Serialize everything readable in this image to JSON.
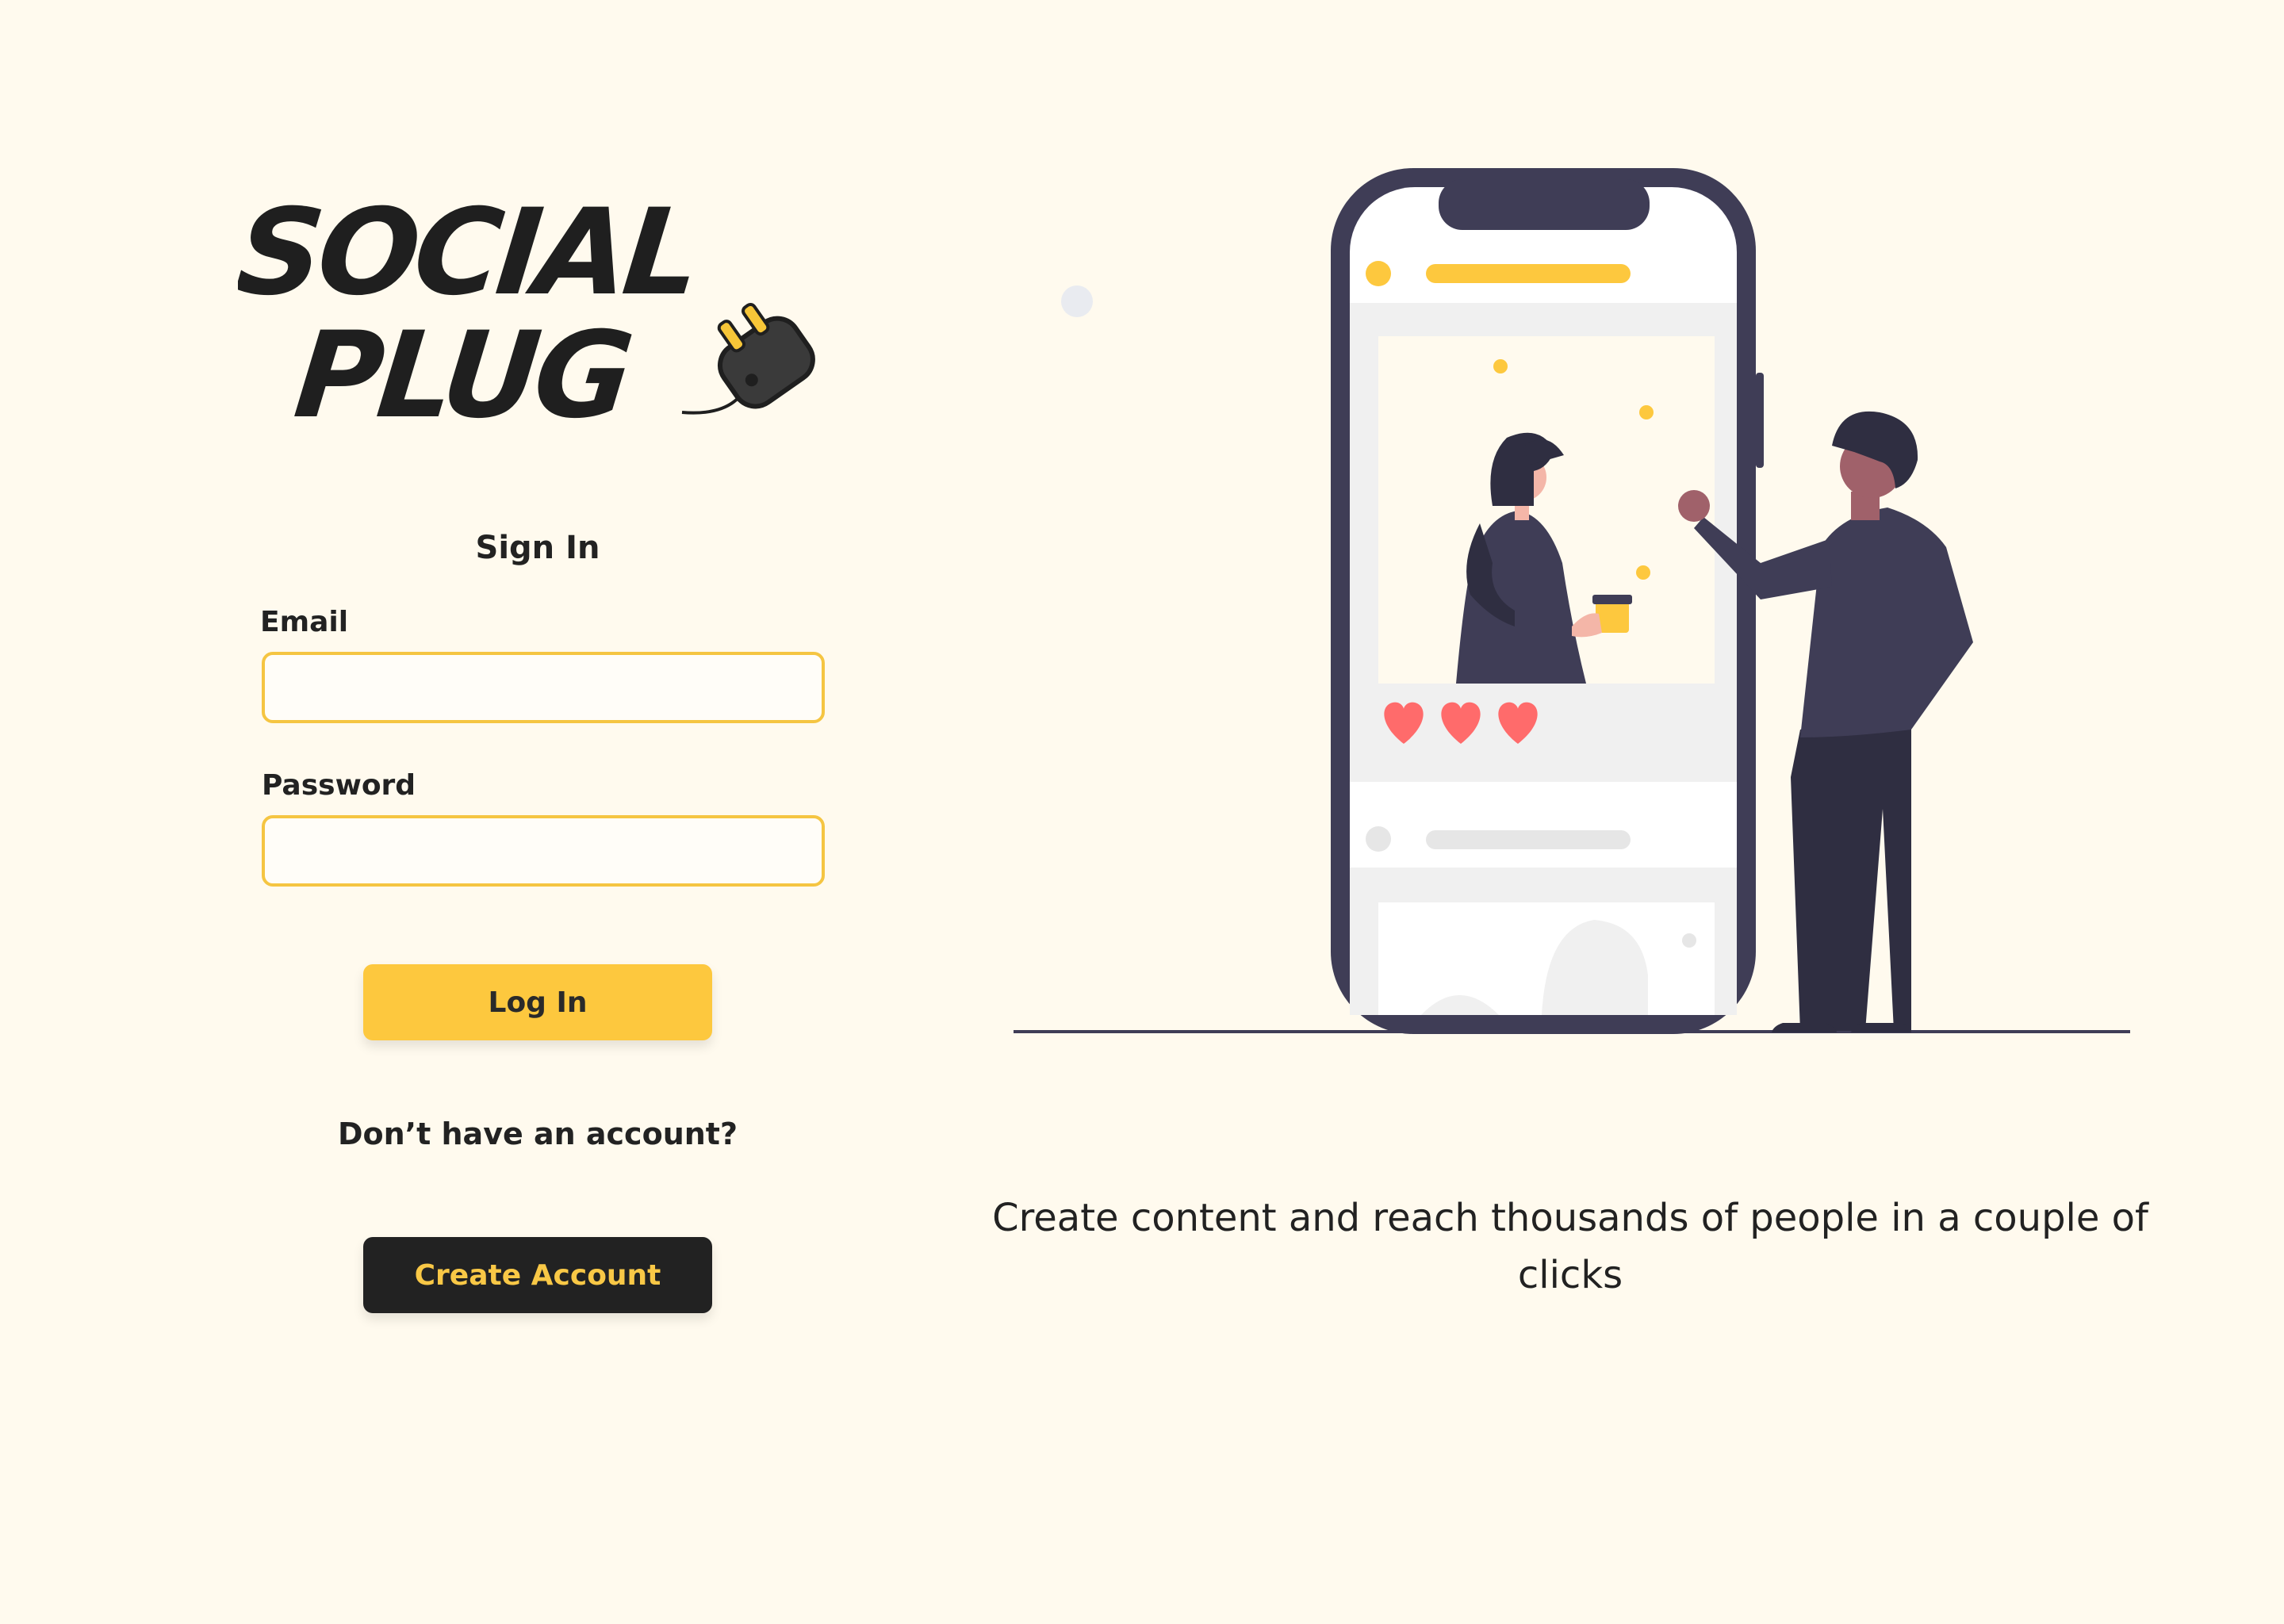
{
  "brand": {
    "line1": "SOCIAL",
    "line2": "PLUG"
  },
  "signin": {
    "title": "Sign In",
    "email_label": "Email",
    "email_value": "",
    "password_label": "Password",
    "password_value": "",
    "login_button": "Log In",
    "no_account_text": "Don’t have an account?",
    "create_button": "Create Account"
  },
  "hero": {
    "tagline": "Create content and reach thousands of people in a couple of clicks",
    "likes_shown": 3
  },
  "colors": {
    "background": "#fffaee",
    "accent": "#fdc83e",
    "dark": "#222222",
    "phone_frame": "#3f3d56",
    "heart": "#ff6b6b"
  },
  "icons": [
    "plug-icon",
    "heart-icon"
  ]
}
